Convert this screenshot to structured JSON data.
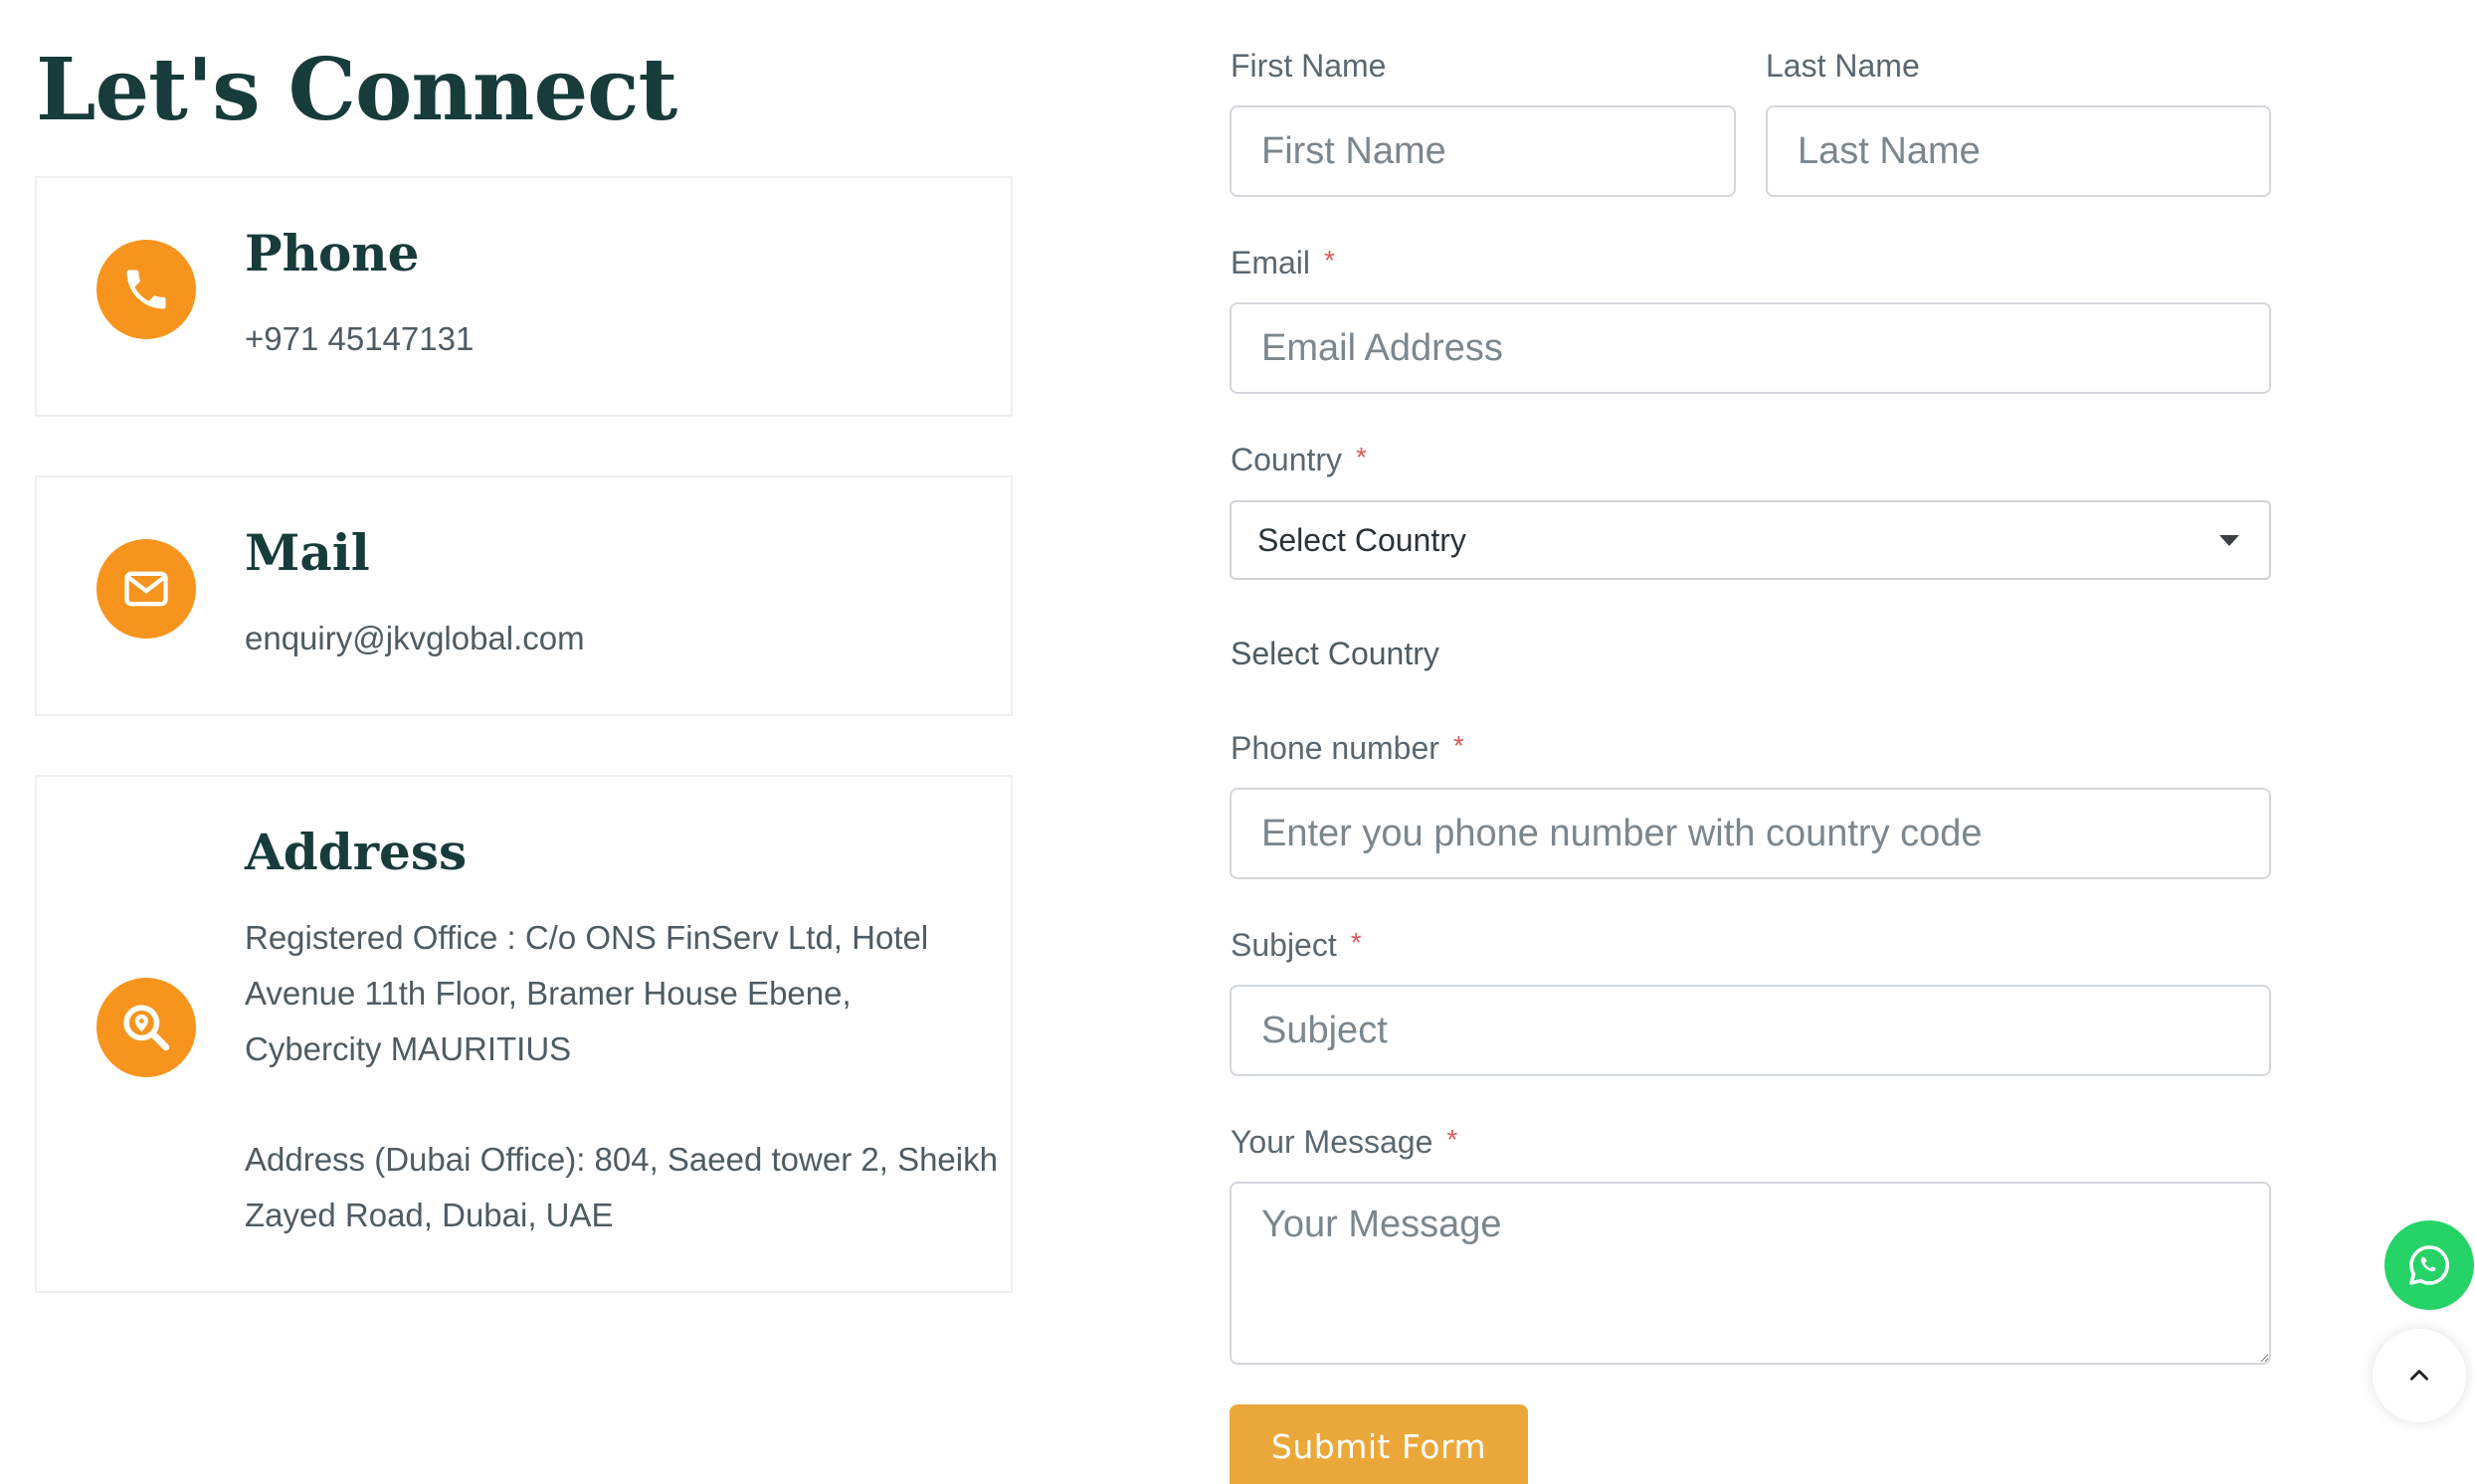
{
  "contact": {
    "heading": "Let's Connect",
    "phone": {
      "title": "Phone",
      "value": "+971 45147131"
    },
    "mail": {
      "title": "Mail",
      "value": "enquiry@jkvglobal.com"
    },
    "address": {
      "title": "Address",
      "registered_line1": "Registered Office : C/o ONS FinServ Ltd, Hotel",
      "registered_line2": "Avenue 11th Floor, Bramer House Ebene,",
      "registered_line3": "Cybercity MAURITIUS",
      "dubai_line1": "Address (Dubai Office): 804, Saeed tower 2, Sheikh",
      "dubai_line2": "Zayed Road, Dubai, UAE"
    }
  },
  "form": {
    "first_name": {
      "label": "First Name",
      "placeholder": "First Name"
    },
    "last_name": {
      "label": "Last Name",
      "placeholder": "Last Name"
    },
    "email": {
      "label": "Email",
      "placeholder": "Email Address"
    },
    "country": {
      "label": "Country",
      "selected": "Select Country",
      "echo": "Select Country"
    },
    "phone": {
      "label": "Phone number",
      "placeholder": "Enter you phone number with country code"
    },
    "subject": {
      "label": "Subject",
      "placeholder": "Subject"
    },
    "message": {
      "label": "Your Message",
      "placeholder": "Your Message"
    },
    "required_mark": "*",
    "submit_label": "Submit Form"
  },
  "icons": {
    "phone": "phone-icon",
    "mail": "envelope-icon",
    "address": "location-search-icon",
    "select_caret": "chevron-down-icon",
    "whatsapp": "whatsapp-icon",
    "scroll_top": "chevron-up-icon"
  },
  "colors": {
    "accent_orange": "#f7941d",
    "heading_green": "#173c3a",
    "submit_button": "#eba83a",
    "whatsapp_green": "#25d366",
    "required_red": "#e05a5a"
  }
}
